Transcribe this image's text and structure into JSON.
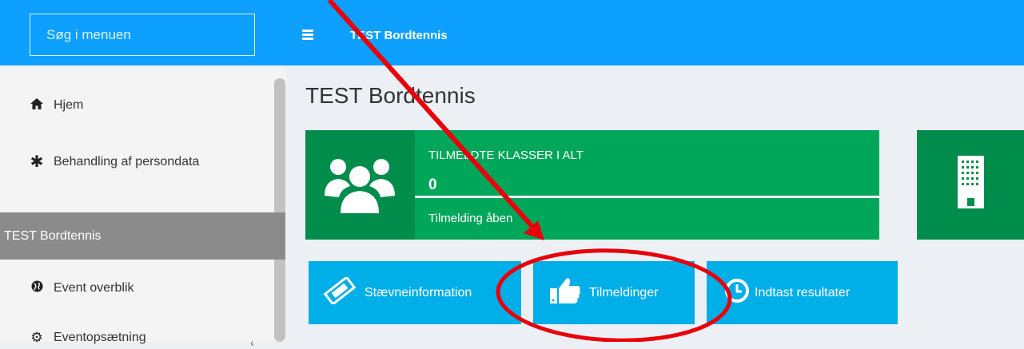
{
  "header": {
    "search_placeholder": "Søg i menuen",
    "title": "TEST Bordtennis"
  },
  "sidebar": {
    "items": [
      {
        "label": "Hjem",
        "icon": "home-icon"
      },
      {
        "label": "Behandling af persondata",
        "icon": "asterisk-icon"
      }
    ],
    "section_header": "TEST Bordtennis",
    "section_items": [
      {
        "label": "Event overblik",
        "icon": "globe-icon"
      },
      {
        "label": "Eventopsætning",
        "icon": "gears-icon"
      }
    ]
  },
  "main": {
    "page_title": "TEST Bordtennis",
    "info_box": {
      "title": "TILMELDTE KLASSER I ALT",
      "number": "0",
      "description": "Tilmelding åben",
      "icon": "users-icon"
    },
    "buttons": [
      {
        "label": "Stævneinformation",
        "icon": "ticket-icon"
      },
      {
        "label": "Tilmeldinger",
        "icon": "thumbs-up-icon"
      },
      {
        "label": "Indtast resultater",
        "icon": "clock-icon"
      }
    ]
  },
  "colors": {
    "topbar": "#0da0ff",
    "info_box": "#00a65a",
    "info_box_icon": "#008d4c",
    "button": "#00aee8",
    "annotation": "#e8000b"
  }
}
